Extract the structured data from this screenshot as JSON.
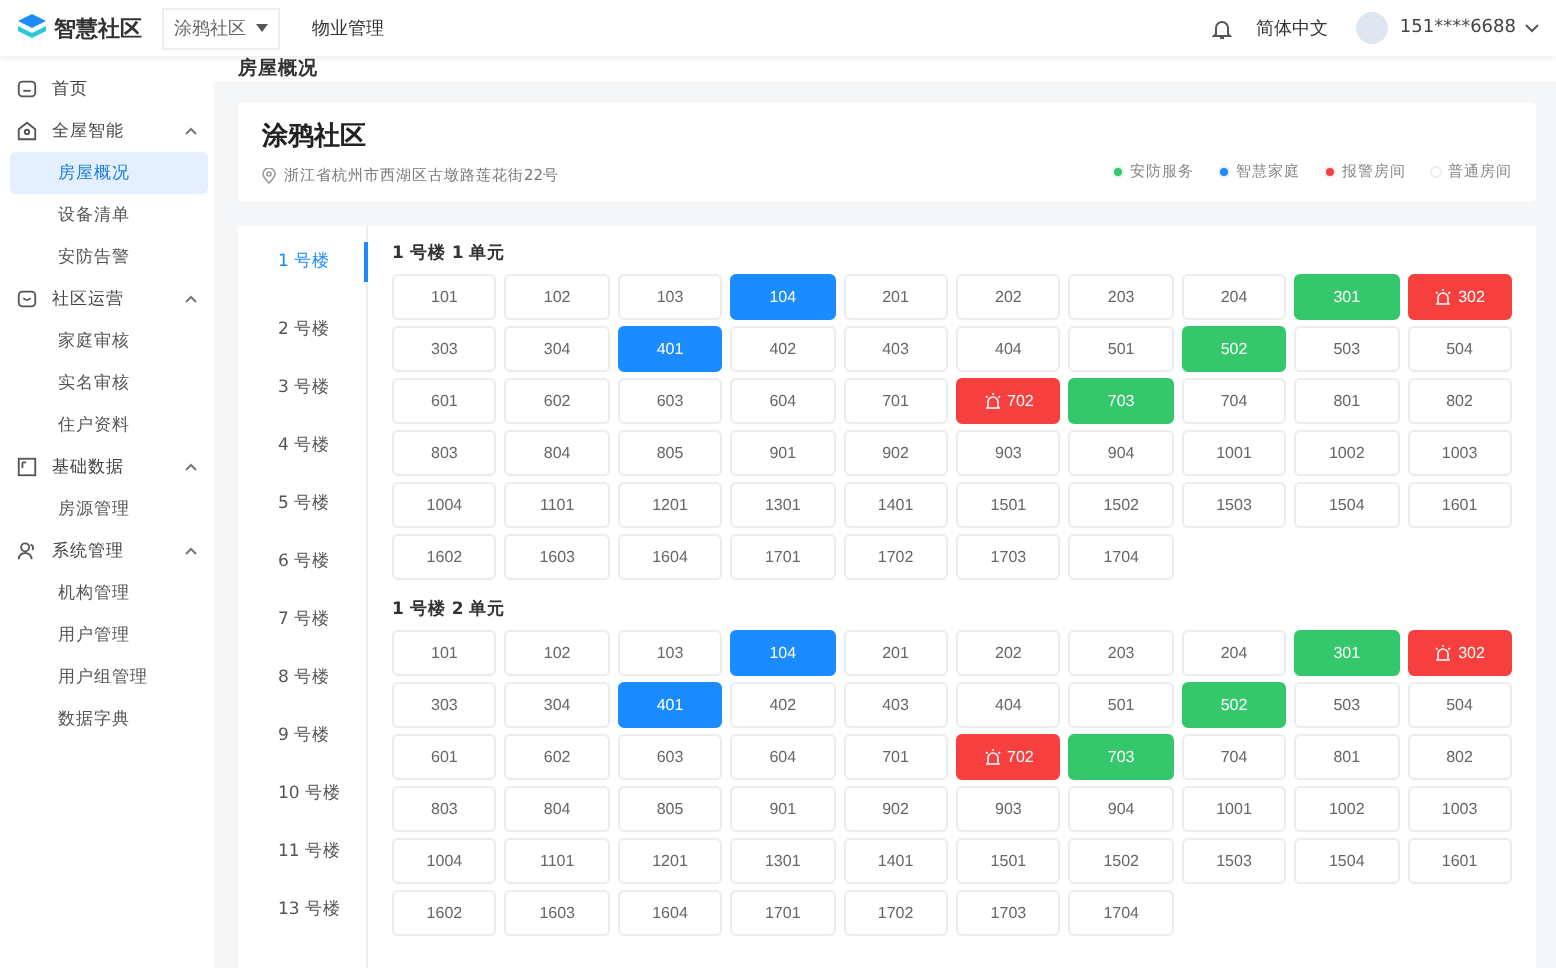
{
  "header": {
    "logo": "智慧社区",
    "community_select": "涂鸦社区",
    "nav": "物业管理",
    "language": "简体中文",
    "user": "151****6688"
  },
  "sidebar": {
    "items": [
      {
        "label": "首页"
      },
      {
        "label": "全屋智能",
        "expanded": true,
        "children": [
          {
            "label": "房屋概况",
            "selected": true
          },
          {
            "label": "设备清单",
            "selected": false
          },
          {
            "label": "安防告警",
            "selected": false
          }
        ]
      },
      {
        "label": "社区运营",
        "expanded": true,
        "children": [
          {
            "label": "家庭审核",
            "selected": false
          },
          {
            "label": "实名审核",
            "selected": false
          },
          {
            "label": "住户资料",
            "selected": false
          }
        ]
      },
      {
        "label": "基础数据",
        "expanded": true,
        "children": [
          {
            "label": "房源管理",
            "selected": false
          }
        ]
      },
      {
        "label": "系统管理",
        "expanded": true,
        "children": [
          {
            "label": "机构管理",
            "selected": false
          },
          {
            "label": "用户管理",
            "selected": false
          },
          {
            "label": "用户组管理",
            "selected": false
          },
          {
            "label": "数据字典",
            "selected": false
          }
        ]
      }
    ]
  },
  "page_title": "房屋概况",
  "community": {
    "name": "涂鸦社区",
    "address": "浙江省杭州市西湖区古墩路莲花街22号"
  },
  "legend": [
    {
      "label": "安防服务",
      "color": "#34c76b"
    },
    {
      "label": "智慧家庭",
      "color": "#1a8cff"
    },
    {
      "label": "报警房间",
      "color": "#f5403f"
    },
    {
      "label": "普通房间",
      "color": "#ffffff"
    }
  ],
  "buildings": [
    {
      "label": "1 号楼",
      "selected": true
    },
    {
      "label": "2 号楼",
      "selected": false
    },
    {
      "label": "3 号楼",
      "selected": false
    },
    {
      "label": "4 号楼",
      "selected": false
    },
    {
      "label": "5 号楼",
      "selected": false
    },
    {
      "label": "6 号楼",
      "selected": false
    },
    {
      "label": "7 号楼",
      "selected": false
    },
    {
      "label": "8 号楼",
      "selected": false
    },
    {
      "label": "9 号楼",
      "selected": false
    },
    {
      "label": "10 号楼",
      "selected": false
    },
    {
      "label": "11 号楼",
      "selected": false
    },
    {
      "label": "13 号楼",
      "selected": false
    }
  ],
  "units": [
    {
      "title": "1 号楼 1 单元",
      "rooms": [
        {
          "number": "101",
          "kind": "normal"
        },
        {
          "number": "102",
          "kind": "normal"
        },
        {
          "number": "103",
          "kind": "normal"
        },
        {
          "number": "104",
          "kind": "smart"
        },
        {
          "number": "201",
          "kind": "normal"
        },
        {
          "number": "202",
          "kind": "normal"
        },
        {
          "number": "203",
          "kind": "normal"
        },
        {
          "number": "204",
          "kind": "normal"
        },
        {
          "number": "301",
          "kind": "security"
        },
        {
          "number": "302",
          "kind": "alarm"
        },
        {
          "number": "303",
          "kind": "normal"
        },
        {
          "number": "304",
          "kind": "normal"
        },
        {
          "number": "401",
          "kind": "smart"
        },
        {
          "number": "402",
          "kind": "normal"
        },
        {
          "number": "403",
          "kind": "normal"
        },
        {
          "number": "404",
          "kind": "normal"
        },
        {
          "number": "501",
          "kind": "normal"
        },
        {
          "number": "502",
          "kind": "security"
        },
        {
          "number": "503",
          "kind": "normal"
        },
        {
          "number": "504",
          "kind": "normal"
        },
        {
          "number": "601",
          "kind": "normal"
        },
        {
          "number": "602",
          "kind": "normal"
        },
        {
          "number": "603",
          "kind": "normal"
        },
        {
          "number": "604",
          "kind": "normal"
        },
        {
          "number": "701",
          "kind": "normal"
        },
        {
          "number": "702",
          "kind": "alarm"
        },
        {
          "number": "703",
          "kind": "security"
        },
        {
          "number": "704",
          "kind": "normal"
        },
        {
          "number": "801",
          "kind": "normal"
        },
        {
          "number": "802",
          "kind": "normal"
        },
        {
          "number": "803",
          "kind": "normal"
        },
        {
          "number": "804",
          "kind": "normal"
        },
        {
          "number": "805",
          "kind": "normal"
        },
        {
          "number": "901",
          "kind": "normal"
        },
        {
          "number": "902",
          "kind": "normal"
        },
        {
          "number": "903",
          "kind": "normal"
        },
        {
          "number": "904",
          "kind": "normal"
        },
        {
          "number": "1001",
          "kind": "normal"
        },
        {
          "number": "1002",
          "kind": "normal"
        },
        {
          "number": "1003",
          "kind": "normal"
        },
        {
          "number": "1004",
          "kind": "normal"
        },
        {
          "number": "1101",
          "kind": "normal"
        },
        {
          "number": "1201",
          "kind": "normal"
        },
        {
          "number": "1301",
          "kind": "normal"
        },
        {
          "number": "1401",
          "kind": "normal"
        },
        {
          "number": "1501",
          "kind": "normal"
        },
        {
          "number": "1502",
          "kind": "normal"
        },
        {
          "number": "1503",
          "kind": "normal"
        },
        {
          "number": "1504",
          "kind": "normal"
        },
        {
          "number": "1601",
          "kind": "normal"
        },
        {
          "number": "1602",
          "kind": "normal"
        },
        {
          "number": "1603",
          "kind": "normal"
        },
        {
          "number": "1604",
          "kind": "normal"
        },
        {
          "number": "1701",
          "kind": "normal"
        },
        {
          "number": "1702",
          "kind": "normal"
        },
        {
          "number": "1703",
          "kind": "normal"
        },
        {
          "number": "1704",
          "kind": "normal"
        }
      ]
    },
    {
      "title": "1 号楼 2 单元",
      "rooms": [
        {
          "number": "101",
          "kind": "normal"
        },
        {
          "number": "102",
          "kind": "normal"
        },
        {
          "number": "103",
          "kind": "normal"
        },
        {
          "number": "104",
          "kind": "smart"
        },
        {
          "number": "201",
          "kind": "normal"
        },
        {
          "number": "202",
          "kind": "normal"
        },
        {
          "number": "203",
          "kind": "normal"
        },
        {
          "number": "204",
          "kind": "normal"
        },
        {
          "number": "301",
          "kind": "security"
        },
        {
          "number": "302",
          "kind": "alarm"
        },
        {
          "number": "303",
          "kind": "normal"
        },
        {
          "number": "304",
          "kind": "normal"
        },
        {
          "number": "401",
          "kind": "smart"
        },
        {
          "number": "402",
          "kind": "normal"
        },
        {
          "number": "403",
          "kind": "normal"
        },
        {
          "number": "404",
          "kind": "normal"
        },
        {
          "number": "501",
          "kind": "normal"
        },
        {
          "number": "502",
          "kind": "security"
        },
        {
          "number": "503",
          "kind": "normal"
        },
        {
          "number": "504",
          "kind": "normal"
        },
        {
          "number": "601",
          "kind": "normal"
        },
        {
          "number": "602",
          "kind": "normal"
        },
        {
          "number": "603",
          "kind": "normal"
        },
        {
          "number": "604",
          "kind": "normal"
        },
        {
          "number": "701",
          "kind": "normal"
        },
        {
          "number": "702",
          "kind": "alarm"
        },
        {
          "number": "703",
          "kind": "security"
        },
        {
          "number": "704",
          "kind": "normal"
        },
        {
          "number": "801",
          "kind": "normal"
        },
        {
          "number": "802",
          "kind": "normal"
        },
        {
          "number": "803",
          "kind": "normal"
        },
        {
          "number": "804",
          "kind": "normal"
        },
        {
          "number": "805",
          "kind": "normal"
        },
        {
          "number": "901",
          "kind": "normal"
        },
        {
          "number": "902",
          "kind": "normal"
        },
        {
          "number": "903",
          "kind": "normal"
        },
        {
          "number": "904",
          "kind": "normal"
        },
        {
          "number": "1001",
          "kind": "normal"
        },
        {
          "number": "1002",
          "kind": "normal"
        },
        {
          "number": "1003",
          "kind": "normal"
        },
        {
          "number": "1004",
          "kind": "normal"
        },
        {
          "number": "1101",
          "kind": "normal"
        },
        {
          "number": "1201",
          "kind": "normal"
        },
        {
          "number": "1301",
          "kind": "normal"
        },
        {
          "number": "1401",
          "kind": "normal"
        },
        {
          "number": "1501",
          "kind": "normal"
        },
        {
          "number": "1502",
          "kind": "normal"
        },
        {
          "number": "1503",
          "kind": "normal"
        },
        {
          "number": "1504",
          "kind": "normal"
        },
        {
          "number": "1601",
          "kind": "normal"
        },
        {
          "number": "1602",
          "kind": "normal"
        },
        {
          "number": "1603",
          "kind": "normal"
        },
        {
          "number": "1604",
          "kind": "normal"
        },
        {
          "number": "1701",
          "kind": "normal"
        },
        {
          "number": "1702",
          "kind": "normal"
        },
        {
          "number": "1703",
          "kind": "normal"
        },
        {
          "number": "1704",
          "kind": "normal"
        }
      ]
    }
  ]
}
